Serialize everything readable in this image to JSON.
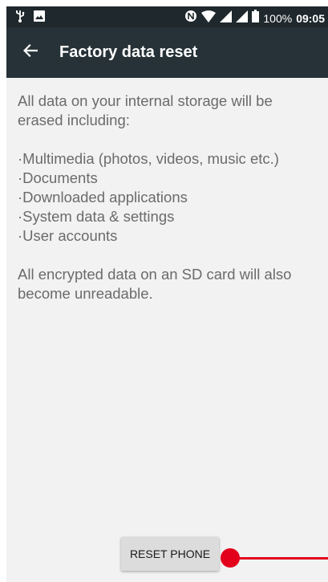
{
  "status_bar": {
    "time": "09:05",
    "battery_percent": "100%",
    "icons": [
      "usb-icon",
      "image-icon",
      "nfc-icon",
      "wifi-icon",
      "signal-icon",
      "signal-icon",
      "battery-icon"
    ]
  },
  "app_bar": {
    "title": "Factory data reset",
    "back_icon": "arrow-back-icon"
  },
  "content": {
    "intro": "All data on your internal storage will be erased including:",
    "items": [
      "·Multimedia (photos, videos, music etc.)",
      "·Documents",
      "·Downloaded applications",
      "·System data & settings",
      "·User accounts"
    ],
    "note": "All encrypted data on an SD card will also become unreadable."
  },
  "actions": {
    "reset_label": "RESET PHONE"
  },
  "colors": {
    "status_bar_bg": "#1f282c",
    "app_bar_bg": "#263237",
    "background": "#f2f2f2",
    "body_text": "#6b6b6b",
    "button_bg": "#dcdcdc",
    "touch_indicator": "#e3001b"
  }
}
